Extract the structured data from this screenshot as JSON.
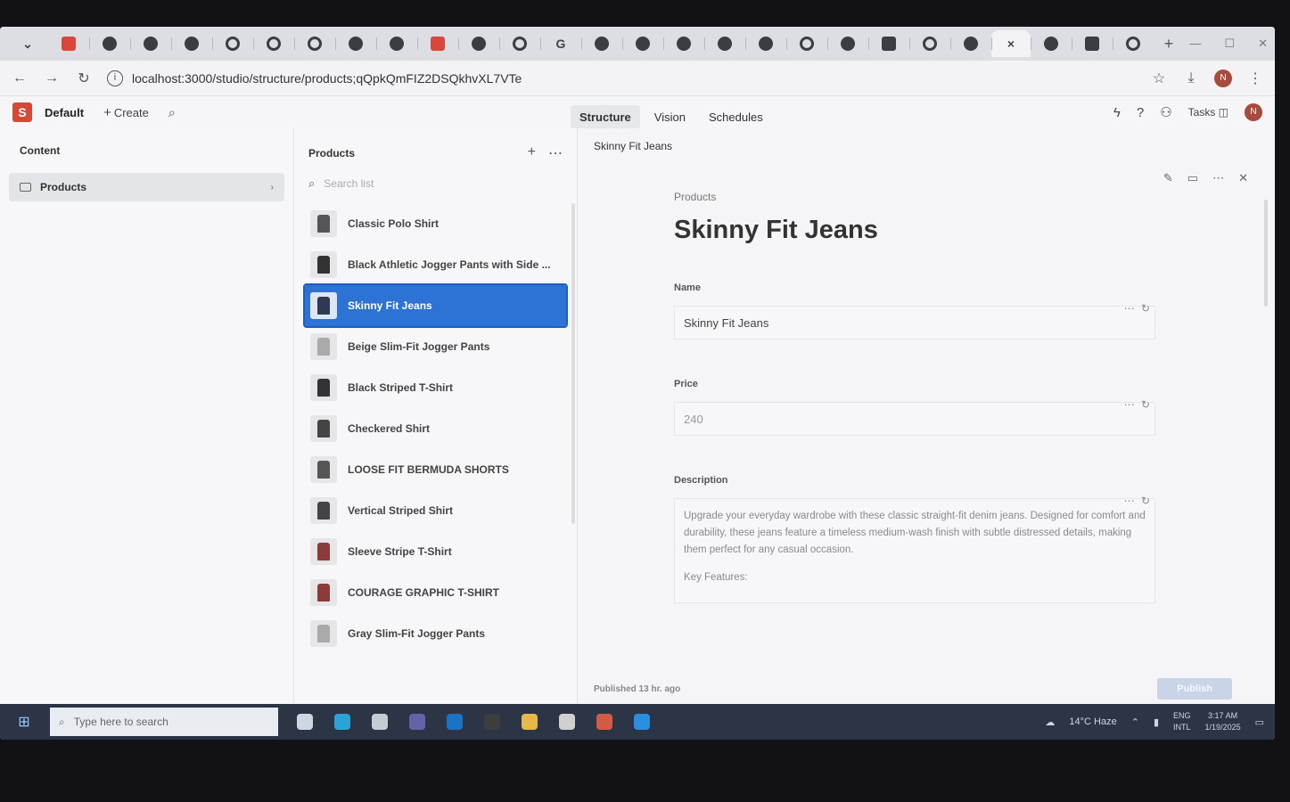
{
  "browser": {
    "tabs": [
      {
        "icon": "sanity-icon"
      },
      {
        "icon": "chrome-icon"
      },
      {
        "icon": "app-icon"
      },
      {
        "icon": "app-icon"
      },
      {
        "icon": "github-icon"
      },
      {
        "icon": "github-icon"
      },
      {
        "icon": "github-icon"
      },
      {
        "icon": "chrome-icon"
      },
      {
        "icon": "app-icon"
      },
      {
        "icon": "youtube-icon"
      },
      {
        "icon": "chrome-icon"
      },
      {
        "icon": "github-icon"
      },
      {
        "icon": "google-icon",
        "glyph": "G"
      },
      {
        "icon": "app-icon"
      },
      {
        "icon": "chrome-icon"
      },
      {
        "icon": "chrome-icon"
      },
      {
        "icon": "chrome-icon"
      },
      {
        "icon": "chrome-icon"
      },
      {
        "icon": "github-icon"
      },
      {
        "icon": "chrome-icon"
      },
      {
        "icon": "flag-icon"
      },
      {
        "icon": "github-icon"
      },
      {
        "icon": "chrome-icon"
      },
      {
        "icon": "close-icon",
        "glyph": "×",
        "active": true
      },
      {
        "icon": "chrome-icon"
      },
      {
        "icon": "calendar-icon"
      },
      {
        "icon": "github-icon"
      }
    ],
    "url": "localhost:3000/studio/structure/products;qQpkQmFIZ2DSQkhvXL7VTe"
  },
  "studio": {
    "workspace": "Default",
    "create_label": "Create",
    "nav_tabs": [
      "Structure",
      "Vision",
      "Schedules"
    ],
    "tasks_label": "Tasks",
    "avatar_initial": "N",
    "accent": "#2d73d6"
  },
  "content_pane": {
    "title": "Content",
    "items": [
      {
        "label": "Products"
      }
    ]
  },
  "products_pane": {
    "title": "Products",
    "search_placeholder": "Search list",
    "documents": [
      {
        "title": "Classic Polo Shirt",
        "thumb": "#555"
      },
      {
        "title": "Black Athletic Jogger Pants with Side ...",
        "thumb": "#333"
      },
      {
        "title": "Skinny Fit Jeans",
        "thumb": "#2f3a52",
        "selected": true
      },
      {
        "title": "Beige Slim-Fit Jogger Pants",
        "thumb": "#aaa"
      },
      {
        "title": "Black Striped T-Shirt",
        "thumb": "#333"
      },
      {
        "title": "Checkered Shirt",
        "thumb": "#444"
      },
      {
        "title": "LOOSE FIT BERMUDA SHORTS",
        "thumb": "#555"
      },
      {
        "title": "Vertical Striped Shirt",
        "thumb": "#444"
      },
      {
        "title": "Sleeve Stripe T-Shirt",
        "thumb": "#8a3b3b"
      },
      {
        "title": "COURAGE GRAPHIC T-SHIRT",
        "thumb": "#8a3b3b"
      },
      {
        "title": "Gray Slim-Fit Jogger Pants",
        "thumb": "#aaa"
      }
    ]
  },
  "editor": {
    "header_title": "Skinny Fit Jeans",
    "doc_type": "Products",
    "doc_title": "Skinny Fit Jeans",
    "fields": {
      "name": {
        "label": "Name",
        "value": "Skinny Fit Jeans"
      },
      "price": {
        "label": "Price",
        "value": "240"
      },
      "description": {
        "label": "Description",
        "paragraph": "Upgrade your everyday wardrobe with these classic straight-fit denim jeans. Designed for comfort and durability, these jeans feature a timeless medium-wash finish with subtle distressed details, making them perfect for any casual occasion.",
        "subheading": "Key Features:"
      }
    },
    "status": "Published 13 hr. ago",
    "publish_label": "Publish"
  },
  "taskbar": {
    "search_placeholder": "Type here to search",
    "apps": [
      {
        "icon": "task-view-icon",
        "color": "#cfd6e2"
      },
      {
        "icon": "edge-icon",
        "color": "#2aa3d9"
      },
      {
        "icon": "calculator-icon",
        "color": "#c7cbd2"
      },
      {
        "icon": "teams-icon",
        "color": "#6264a7"
      },
      {
        "icon": "outlook-icon",
        "color": "#1a73c7"
      },
      {
        "icon": "terminal-icon",
        "color": "#3d3d3d"
      },
      {
        "icon": "file-explorer-icon",
        "color": "#e6b84a"
      },
      {
        "icon": "chrome-icon",
        "color": "#d0d0d0"
      },
      {
        "icon": "chrome-icon",
        "color": "#d25a47"
      },
      {
        "icon": "vscode-icon",
        "color": "#2a8fe0"
      }
    ],
    "weather": "14°C  Haze",
    "lang_top": "ENG",
    "lang_bottom": "INTL",
    "time": "3:17 AM",
    "date": "1/19/2025"
  }
}
